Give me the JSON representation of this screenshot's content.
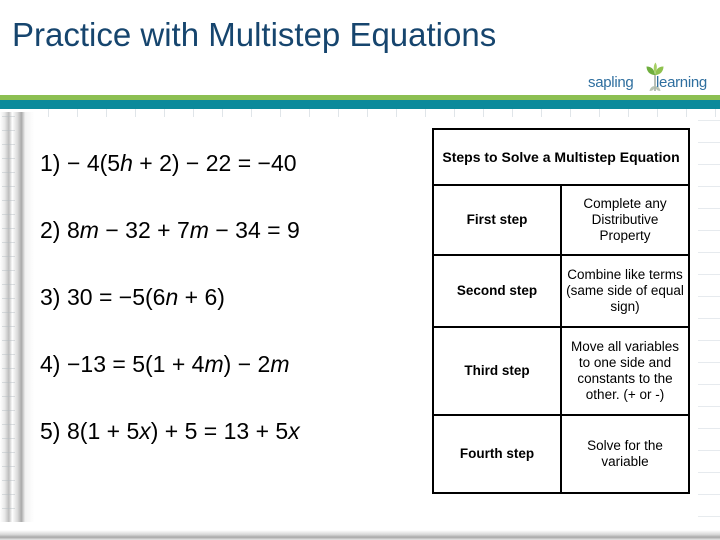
{
  "header": {
    "title": "Practice with Multistep Equations",
    "logo": {
      "word1": "sapling",
      "word2": "learning",
      "icon": "sapling-plant-icon"
    },
    "colors": {
      "title": "#16456e",
      "bar_green": "#8cbf52",
      "bar_teal": "#0b8a9b",
      "logo_text": "#2f6f9f"
    }
  },
  "equations": [
    {
      "number": "1)",
      "parts": [
        {
          "t": "− 4(5",
          "i": false
        },
        {
          "t": "h",
          "i": true
        },
        {
          "t": " + 2) − 22 = −40",
          "i": false
        }
      ]
    },
    {
      "number": "2)",
      "parts": [
        {
          "t": "8",
          "i": false
        },
        {
          "t": "m",
          "i": true
        },
        {
          "t": " − 32 + 7",
          "i": false
        },
        {
          "t": "m",
          "i": true
        },
        {
          "t": " − 34 = 9",
          "i": false
        }
      ]
    },
    {
      "number": "3)",
      "parts": [
        {
          "t": "30 = −5(6",
          "i": false
        },
        {
          "t": "n",
          "i": true
        },
        {
          "t": " + 6)",
          "i": false
        }
      ]
    },
    {
      "number": "4)",
      "parts": [
        {
          "t": "−13 = 5(1 + 4",
          "i": false
        },
        {
          "t": "m",
          "i": true
        },
        {
          "t": ") − 2",
          "i": false
        },
        {
          "t": "m",
          "i": true
        }
      ]
    },
    {
      "number": "5)",
      "parts": [
        {
          "t": "8(1 + 5",
          "i": false
        },
        {
          "t": "x",
          "i": true
        },
        {
          "t": ") + 5 = 13 + 5",
          "i": false
        },
        {
          "t": "x",
          "i": true
        }
      ]
    }
  ],
  "steps_table": {
    "header": "Steps to Solve a Multistep Equation",
    "rows": [
      {
        "label": "First step",
        "description": "Complete any Distributive Property"
      },
      {
        "label": "Second step",
        "description": "Combine like terms (same side of equal sign)"
      },
      {
        "label": "Third step",
        "description": "Move all variables to one side and constants to the other. (+ or -)"
      },
      {
        "label": "Fourth step",
        "description": "Solve for the variable"
      }
    ]
  }
}
